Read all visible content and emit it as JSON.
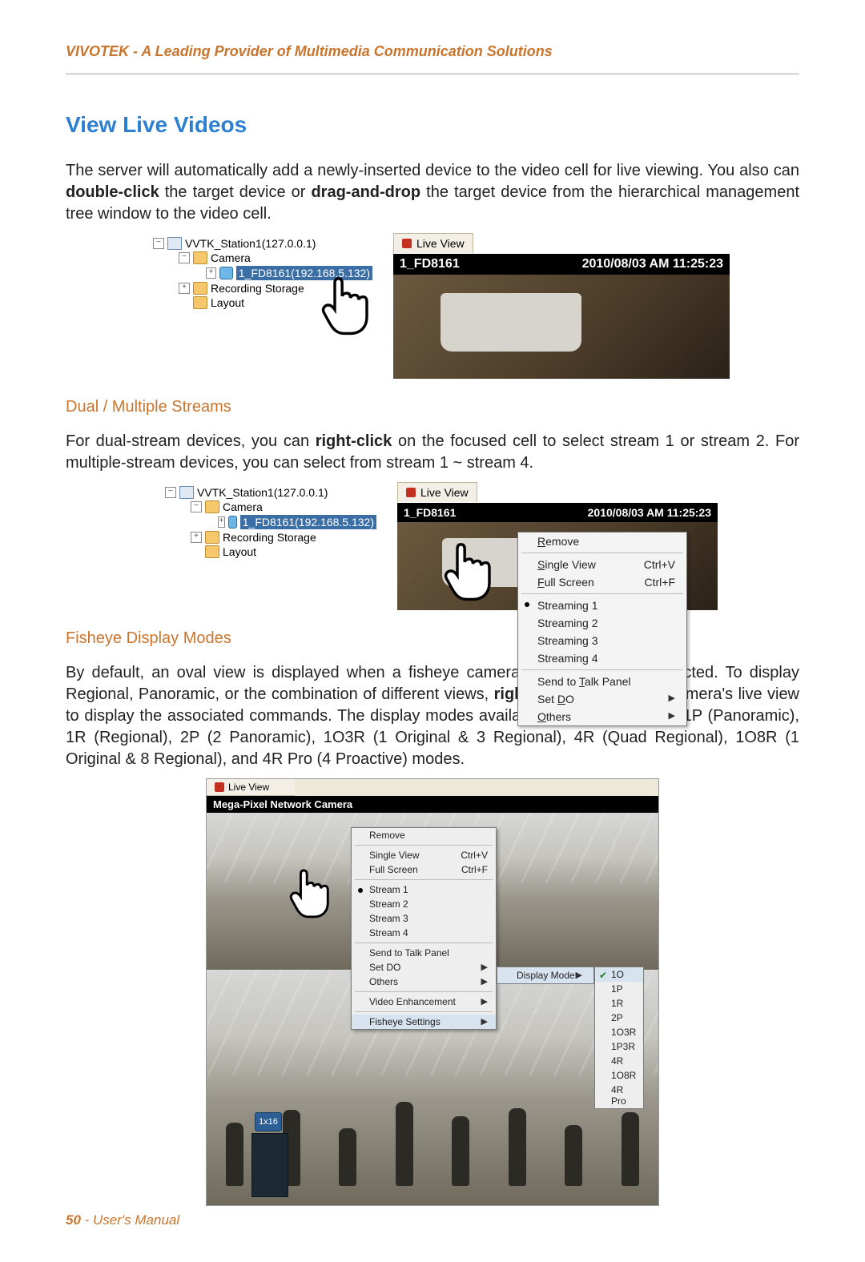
{
  "header": {
    "brand": "VIVOTEK - A Leading Provider of Multimedia Communication Solutions"
  },
  "title": "View Live Videos",
  "para1_a": "The server will automatically add a newly-inserted device to the video cell for live viewing. You also can ",
  "para1_b": "double-click",
  "para1_c": " the target device or ",
  "para1_d": "drag-and-drop",
  "para1_e": " the target device from the hierarchical management tree window to the video cell.",
  "tree": {
    "station": "VVTK_Station1(127.0.0.1)",
    "camera_folder": "Camera",
    "camera_item": "1_FD8161(192.168.5.132)",
    "recording": "Recording Storage",
    "layout": "Layout"
  },
  "live": {
    "tab": "Live View",
    "cell_name": "1_FD8161",
    "timestamp": "2010/08/03 AM 11:25:23"
  },
  "h2_streams": "Dual / Multiple Streams",
  "para2_a": "For dual-stream devices, you can ",
  "para2_b": "right-click",
  "para2_c": " on the focused cell to select stream 1 or stream 2. For multiple-stream devices, you can select from stream 1 ~ stream 4.",
  "ctx": {
    "remove": "Remove",
    "single": "Single View",
    "single_sc": "Ctrl+V",
    "full": "Full Screen",
    "full_sc": "Ctrl+F",
    "s1": "Streaming 1",
    "s2": "Streaming 2",
    "s3": "Streaming 3",
    "s4": "Streaming 4",
    "talk": "Send to Talk Panel",
    "setdo": "Set DO",
    "others": "Others"
  },
  "h2_fisheye": "Fisheye Display Modes",
  "para3_a": "By default, an oval view is displayed when a fisheye camera is successfully connected. To display Regional, Panoramic, or the combination of different views, ",
  "para3_b": "right-click",
  "para3_c": " on a fisheye camera's live view to display the associated commands. The display modes available are: 1O (Original), 1P (Panoramic), 1R (Regional), 2P (2 Panoramic), 1O3R (1 Original & 3 Regional), 4R (Quad Regional), 1O8R (1 Original & 8 Regional), and 4R Pro (4 Proactive) modes.",
  "fisheye": {
    "tab": "Live View",
    "title": "Mega-Pixel Network Camera",
    "menu": {
      "remove": "Remove",
      "single": "Single View",
      "single_sc": "Ctrl+V",
      "full": "Full Screen",
      "full_sc": "Ctrl+F",
      "s1": "Stream 1",
      "s2": "Stream 2",
      "s3": "Stream 3",
      "s4": "Stream 4",
      "talk": "Send to Talk Panel",
      "setdo": "Set DO",
      "others": "Others",
      "ve": "Video Enhancement",
      "fs": "Fisheye Settings"
    },
    "submenu_dm": "Display Mode",
    "modes": [
      "1O",
      "1P",
      "1R",
      "2P",
      "1O3R",
      "1P3R",
      "4R",
      "1O8R",
      "4R Pro"
    ],
    "layout_btn": "1x16"
  },
  "footer": {
    "page": "50",
    "sep": " - ",
    "label": "User's Manual"
  }
}
